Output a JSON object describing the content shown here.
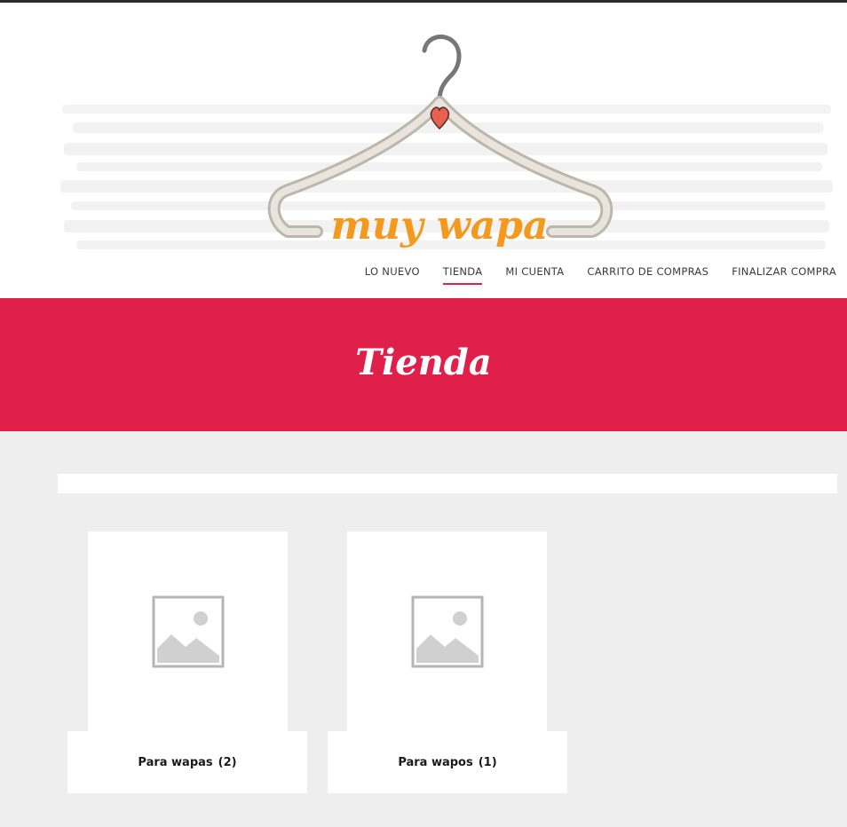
{
  "header": {
    "logo_text": "muy wapa",
    "nav": [
      {
        "label": "LO NUEVO",
        "active": false
      },
      {
        "label": "TIENDA",
        "active": true
      },
      {
        "label": "MI CUENTA",
        "active": false
      },
      {
        "label": "CARRITO DE COMPRAS",
        "active": false
      },
      {
        "label": "FINALIZAR COMPRA",
        "active": false
      }
    ]
  },
  "banner": {
    "title": "Tienda",
    "color": "#e0204a"
  },
  "categories": [
    {
      "name": "Para wapas",
      "count": "(2)",
      "icon": "image-placeholder-icon"
    },
    {
      "name": "Para wapos",
      "count": "(1)",
      "icon": "image-placeholder-icon"
    }
  ],
  "colors": {
    "accent": "#e0204a",
    "logo_orange": "#f39a1e",
    "background": "#eeeeee"
  }
}
